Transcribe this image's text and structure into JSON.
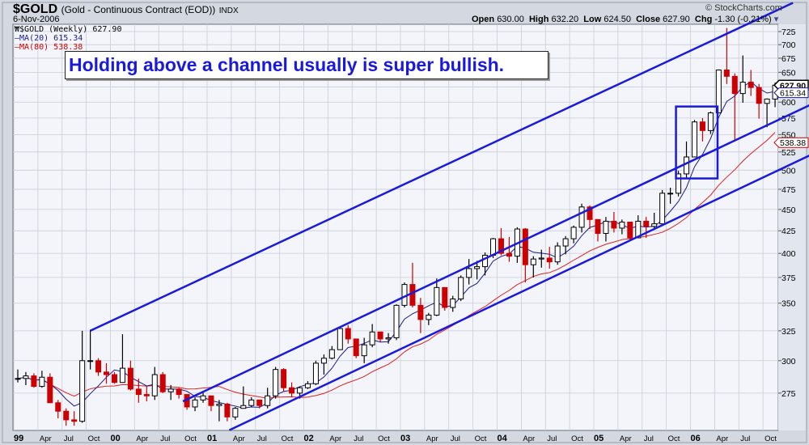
{
  "header": {
    "symbol": "$GOLD",
    "description": "(Gold - Continuous Contract (EOD))",
    "exchange": "INDX",
    "date": "6-Nov-2006",
    "watermark": "© StockCharts.com",
    "open_label": "Open",
    "open": "630.00",
    "high_label": "High",
    "high": "632.20",
    "low_label": "Low",
    "low": "624.50",
    "close_label": "Close",
    "close": "627.90",
    "chg_label": "Chg",
    "chg": "-1.30 (-0.21%)"
  },
  "legend": {
    "price": "$GOLD (Weekly) 627.90",
    "ma20": "MA(20) 615.34",
    "ma80": "MA(80) 538.38"
  },
  "annotation": "Holding above a channel usually is super bullish.",
  "colors": {
    "up": "#000000",
    "down": "#cc0000",
    "ma20": "#1a1a8c",
    "ma80": "#dd2020",
    "trendline": "#1a1adc",
    "grid": "#c9cdd8",
    "plot_bg": "#f3f5fa"
  },
  "chart_data": {
    "type": "candlestick",
    "scale": "log",
    "ylim": [
      250,
      735
    ],
    "xlim": [
      "1999-01",
      "2006-11"
    ],
    "grid": true,
    "y_ticks": [
      275,
      300,
      325,
      350,
      375,
      400,
      425,
      450,
      475,
      500,
      525,
      550,
      575,
      600,
      625,
      650,
      675,
      700,
      725
    ],
    "x_tick_labels": [
      "99",
      "Apr",
      "Jul",
      "Oct",
      "00",
      "Apr",
      "Jul",
      "Oct",
      "01",
      "Apr",
      "Jul",
      "Oct",
      "02",
      "Apr",
      "Jul",
      "Oct",
      "03",
      "Apr",
      "Jul",
      "Oct",
      "04",
      "Apr",
      "Jul",
      "Oct",
      "05",
      "Apr",
      "Jul",
      "Oct",
      "06",
      "Apr",
      "Jul",
      "Oct"
    ],
    "last_values": {
      "close": "627.90",
      "ma20": "615.34",
      "ma80": "538.38"
    },
    "start": "1999-01",
    "close": [
      286,
      288,
      280,
      287,
      268,
      262,
      256,
      255,
      300,
      300,
      291,
      289,
      283,
      294,
      278,
      274,
      273,
      289,
      276,
      278,
      274,
      265,
      270,
      273,
      266,
      267,
      258,
      264,
      266,
      270,
      266,
      273,
      293,
      279,
      275,
      279,
      282,
      298,
      302,
      309,
      327,
      318,
      304,
      313,
      324,
      318,
      319,
      348,
      368,
      348,
      335,
      339,
      365,
      346,
      354,
      375,
      384,
      386,
      398,
      416,
      400,
      397,
      427,
      388,
      394,
      395,
      391,
      408,
      416,
      429,
      453,
      438,
      422,
      436,
      428,
      435,
      417,
      436,
      430,
      433,
      470,
      470,
      495,
      518,
      569,
      556,
      583,
      654,
      643,
      614,
      633,
      624,
      598,
      605,
      627.9
    ],
    "high": [
      293,
      291,
      290,
      292,
      290,
      270,
      264,
      262,
      325,
      326,
      302,
      298,
      291,
      322,
      300,
      286,
      280,
      295,
      291,
      281,
      279,
      274,
      272,
      276,
      272,
      270,
      268,
      265,
      280,
      272,
      270,
      279,
      295,
      294,
      283,
      280,
      284,
      300,
      305,
      312,
      328,
      330,
      318,
      319,
      331,
      323,
      323,
      349,
      370,
      390,
      355,
      341,
      374,
      365,
      357,
      377,
      394,
      392,
      401,
      417,
      428,
      418,
      429,
      428,
      397,
      404,
      407,
      412,
      419,
      431,
      457,
      455,
      428,
      441,
      447,
      438,
      434,
      443,
      441,
      446,
      474,
      477,
      499,
      540,
      572,
      575,
      585,
      655,
      732,
      648,
      680,
      654,
      630,
      606,
      632.2
    ],
    "low": [
      283,
      281,
      279,
      279,
      268,
      257,
      252,
      252,
      254,
      293,
      288,
      282,
      282,
      283,
      277,
      268,
      269,
      270,
      275,
      270,
      271,
      263,
      262,
      268,
      262,
      255,
      255,
      256,
      264,
      265,
      264,
      264,
      271,
      276,
      272,
      271,
      278,
      281,
      289,
      301,
      309,
      314,
      302,
      298,
      311,
      315,
      314,
      317,
      346,
      346,
      323,
      330,
      338,
      343,
      342,
      352,
      368,
      373,
      377,
      395,
      398,
      391,
      390,
      370,
      375,
      385,
      384,
      388,
      399,
      411,
      423,
      427,
      413,
      413,
      423,
      421,
      414,
      419,
      417,
      426,
      436,
      457,
      466,
      489,
      520,
      540,
      551,
      584,
      630,
      542,
      599,
      610,
      574,
      561,
      592
    ],
    "trendlines": [
      {
        "from": [
          1999.79,
          325
        ],
        "to": [
          2007.06,
          783
        ]
      },
      {
        "from": [
          2000.75,
          269
        ],
        "to": [
          2007.23,
          595
        ]
      },
      {
        "from": [
          2001.23,
          249
        ],
        "to": [
          2007.23,
          520
        ]
      }
    ],
    "highlight_box": {
      "from": [
        2005.85,
        593
      ],
      "to": [
        2006.28,
        489
      ]
    }
  }
}
